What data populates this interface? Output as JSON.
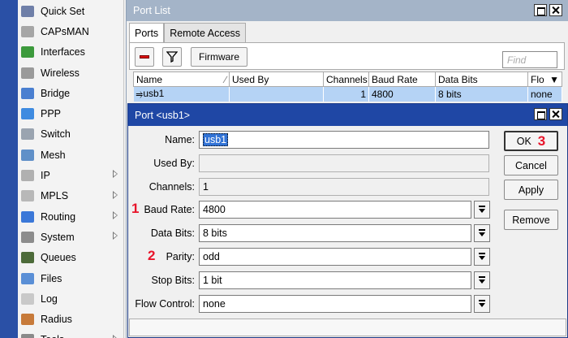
{
  "sidebar": {
    "items": [
      {
        "label": "Quick Set",
        "icon": "quick-set-icon",
        "color": "#6f7fa8",
        "submenu": false
      },
      {
        "label": "CAPsMAN",
        "icon": "capsman-icon",
        "color": "#a6a6a6",
        "submenu": false
      },
      {
        "label": "Interfaces",
        "icon": "interfaces-icon",
        "color": "#3c9a3c",
        "submenu": false
      },
      {
        "label": "Wireless",
        "icon": "wireless-icon",
        "color": "#9a9a9a",
        "submenu": false
      },
      {
        "label": "Bridge",
        "icon": "bridge-icon",
        "color": "#4a7fd0",
        "submenu": false
      },
      {
        "label": "PPP",
        "icon": "ppp-icon",
        "color": "#3f8be0",
        "submenu": false
      },
      {
        "label": "Switch",
        "icon": "switch-icon",
        "color": "#9aa4b0",
        "submenu": false
      },
      {
        "label": "Mesh",
        "icon": "mesh-icon",
        "color": "#6090c8",
        "submenu": false
      },
      {
        "label": "IP",
        "icon": "ip-icon",
        "color": "#b0b0b0",
        "submenu": true
      },
      {
        "label": "MPLS",
        "icon": "mpls-icon",
        "color": "#b8b8b8",
        "submenu": true
      },
      {
        "label": "Routing",
        "icon": "routing-icon",
        "color": "#3b78d8",
        "submenu": true
      },
      {
        "label": "System",
        "icon": "system-icon",
        "color": "#8c8c8c",
        "submenu": true
      },
      {
        "label": "Queues",
        "icon": "queues-icon",
        "color": "#4d6b3a",
        "submenu": false
      },
      {
        "label": "Files",
        "icon": "files-icon",
        "color": "#5a8fd6",
        "submenu": false
      },
      {
        "label": "Log",
        "icon": "log-icon",
        "color": "#c9c9c9",
        "submenu": false
      },
      {
        "label": "Radius",
        "icon": "radius-icon",
        "color": "#c77a3a",
        "submenu": false
      },
      {
        "label": "Tools",
        "icon": "tools-icon",
        "color": "#8a8a8a",
        "submenu": true
      }
    ]
  },
  "port_list": {
    "title": "Port List",
    "tabs": [
      "Ports",
      "Remote Access"
    ],
    "toolbar": {
      "firmware": "Firmware",
      "find_placeholder": "Find"
    },
    "columns": [
      "Name",
      "Used By",
      "Channels",
      "Baud Rate",
      "Data Bits",
      "Flo"
    ],
    "rows": [
      {
        "name": "usb1",
        "used_by": "",
        "channels": "1",
        "baud_rate": "4800",
        "data_bits": "8 bits",
        "flow": "none"
      }
    ]
  },
  "dialog": {
    "title": "Port <usb1>",
    "fields": {
      "name": {
        "label": "Name:",
        "value": "usb1"
      },
      "used_by": {
        "label": "Used By:",
        "value": ""
      },
      "channels": {
        "label": "Channels:",
        "value": "1"
      },
      "baud_rate": {
        "label": "Baud Rate:",
        "value": "4800"
      },
      "data_bits": {
        "label": "Data Bits:",
        "value": "8 bits"
      },
      "parity": {
        "label": "Parity:",
        "value": "odd"
      },
      "stop_bits": {
        "label": "Stop Bits:",
        "value": "1 bit"
      },
      "flow_control": {
        "label": "Flow Control:",
        "value": "none"
      }
    },
    "buttons": {
      "ok": "OK",
      "cancel": "Cancel",
      "apply": "Apply",
      "remove": "Remove"
    },
    "annotations": {
      "baud": "1",
      "parity": "2",
      "ok": "3"
    }
  },
  "colors": {
    "sidebar_strip": "#2a50a6",
    "dialog_title": "#1f47a5",
    "list_title": "#a4b4c8",
    "selection": "#b5d3f5",
    "annotation": "#e8142a"
  }
}
